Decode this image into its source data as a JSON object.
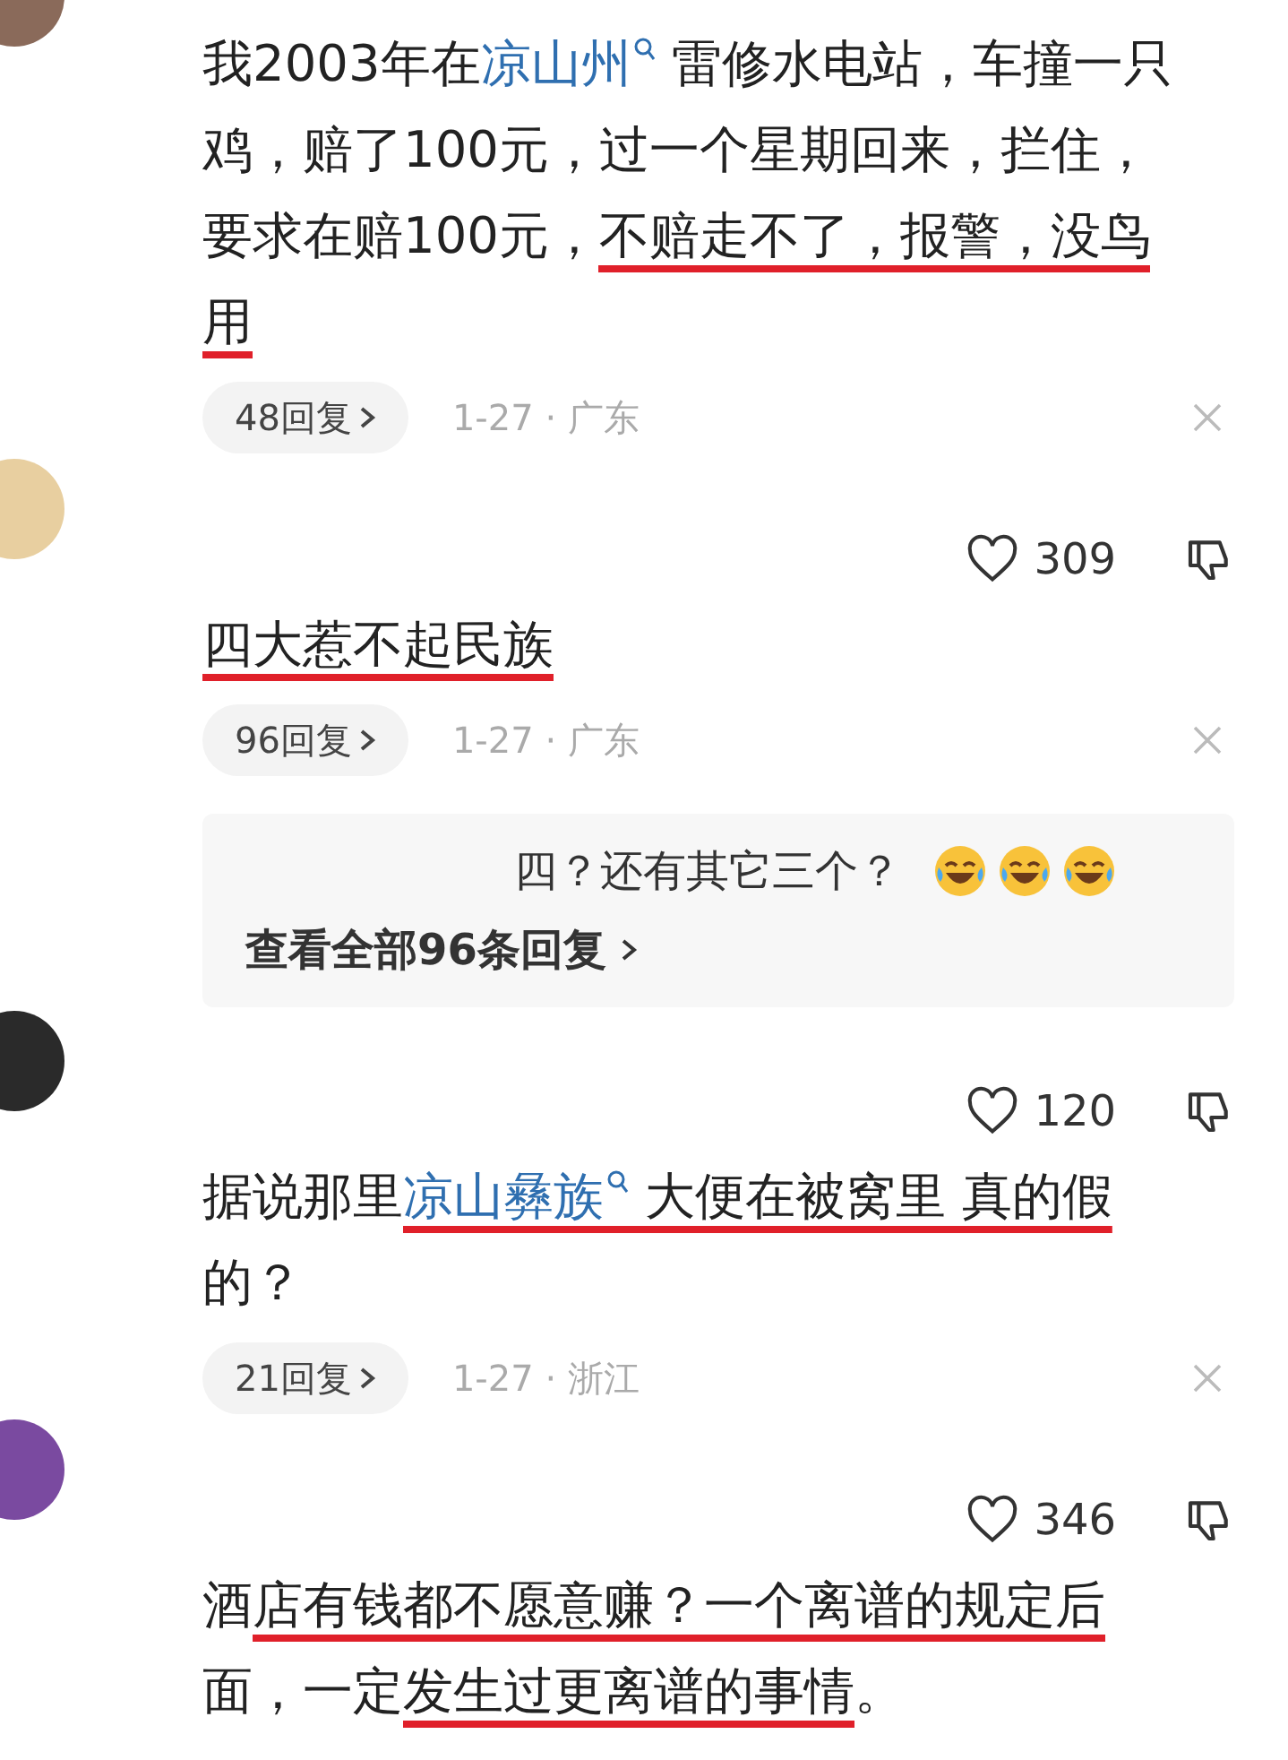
{
  "comments": [
    {
      "parts": [
        {
          "kind": "text",
          "text": "我2003年在",
          "underlined": false
        },
        {
          "kind": "link",
          "text": "凉山州",
          "underlined": false
        },
        {
          "kind": "text",
          "text": " 雷修水电站，车撞一只鸡，赔了100元，过一个星期回来，拦住，要求在赔100元，",
          "underlined": false
        },
        {
          "kind": "text",
          "text": "不赔走不了，报警，没鸟用",
          "underlined": true
        }
      ],
      "replies": "48回复",
      "meta": "1-27 · 广东"
    },
    {
      "likes": "309",
      "parts": [
        {
          "kind": "text",
          "text": "四大惹不起民族",
          "underlined": true
        }
      ],
      "replies": "96回复",
      "meta": "1-27 · 广东",
      "sub": {
        "text": "四？还有其它三个？",
        "more": "查看全部96条回复"
      }
    },
    {
      "likes": "120",
      "parts": [
        {
          "kind": "text",
          "text": "据说那里",
          "underlined": false
        },
        {
          "kind": "link",
          "text": "凉山彝族",
          "underlined": true
        },
        {
          "kind": "text",
          "text": " 大便在被窝里 真的假",
          "underlined": true
        },
        {
          "kind": "text",
          "text": "的？",
          "underlined": false
        }
      ],
      "replies": "21回复",
      "meta": "1-27 · 浙江"
    },
    {
      "likes": "346",
      "parts": [
        {
          "kind": "text",
          "text": "酒",
          "underlined": false
        },
        {
          "kind": "text",
          "text": "店有钱都不愿意赚？一个离谱的规定后",
          "underlined": true
        },
        {
          "kind": "text",
          "text": "面，一定",
          "underlined": false
        },
        {
          "kind": "text",
          "text": "发生过更离谱的事情",
          "underlined": true
        },
        {
          "kind": "text",
          "text": "。",
          "underlined": false
        }
      ]
    }
  ]
}
